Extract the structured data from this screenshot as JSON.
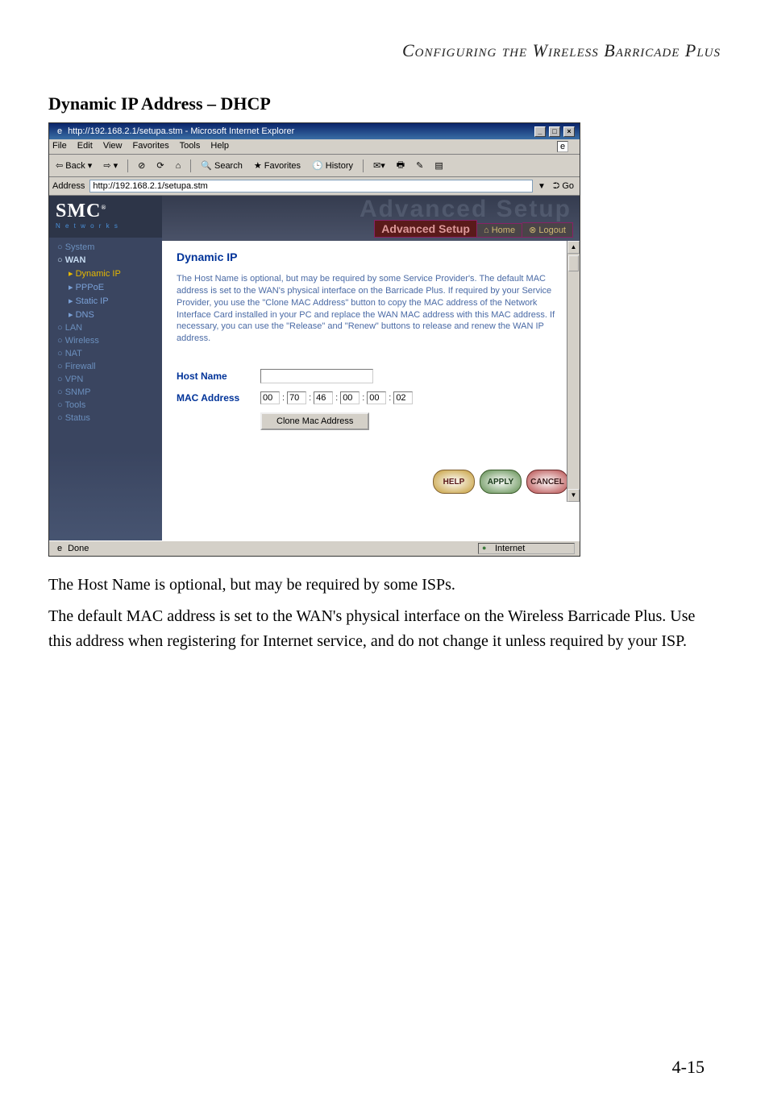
{
  "page_header": "Configuring the Wireless Barricade Plus",
  "section_title": "Dynamic IP Address – DHCP",
  "browser": {
    "title": "http://192.168.2.1/setupa.stm - Microsoft Internet Explorer",
    "menus": [
      "File",
      "Edit",
      "View",
      "Favorites",
      "Tools",
      "Help"
    ],
    "toolbar": {
      "back": "Back",
      "search": "Search",
      "favorites": "Favorites",
      "history": "History"
    },
    "address_label": "Address",
    "address_value": "http://192.168.2.1/setupa.stm",
    "go_label": "Go",
    "status_done": "Done",
    "status_zone": "Internet"
  },
  "brand": {
    "name": "SMC",
    "tag": "N e t w o r k s"
  },
  "banner": {
    "watermark": "Advanced Setup",
    "badge": "Advanced Setup",
    "home": "Home",
    "logout": "Logout",
    "home_sym": "⌂",
    "logout_sym": "⊗"
  },
  "nav": {
    "system": "System",
    "wan": "WAN",
    "dynamic": "Dynamic IP",
    "pppoe": "PPPoE",
    "static": "Static IP",
    "dns": "DNS",
    "lan": "LAN",
    "wireless": "Wireless",
    "nat": "NAT",
    "firewall": "Firewall",
    "vpn": "VPN",
    "snmp": "SNMP",
    "tools": "Tools",
    "status": "Status",
    "bullet": "○",
    "sub_bullet": "▸"
  },
  "panel": {
    "heading": "Dynamic IP",
    "description": "The Host Name is optional, but may be required by some Service Provider's. The default MAC address is set to the WAN's physical interface on the Barricade Plus.  If required by your Service Provider, you use the \"Clone MAC Address\" button to copy the MAC address of the Network Interface Card installed in your PC and replace the WAN MAC address with this MAC address. If necessary, you can use the \"Release\" and \"Renew\" buttons to release and renew the WAN IP address.",
    "host_name_label": "Host Name",
    "host_name_value": "",
    "mac_label": "MAC Address",
    "mac": [
      "00",
      "70",
      "46",
      "00",
      "00",
      "02"
    ],
    "clone_btn": "Clone Mac Address",
    "help": "HELP",
    "apply": "APPLY",
    "cancel": "CANCEL",
    "colon": ":"
  },
  "body_paragraphs": [
    "The Host Name is optional, but may be required by some ISPs.",
    "The default MAC address is set to the WAN's physical interface on the Wireless Barricade Plus. Use this address when registering for Internet service, and do not change it unless required by your ISP."
  ],
  "page_number": "4-15"
}
